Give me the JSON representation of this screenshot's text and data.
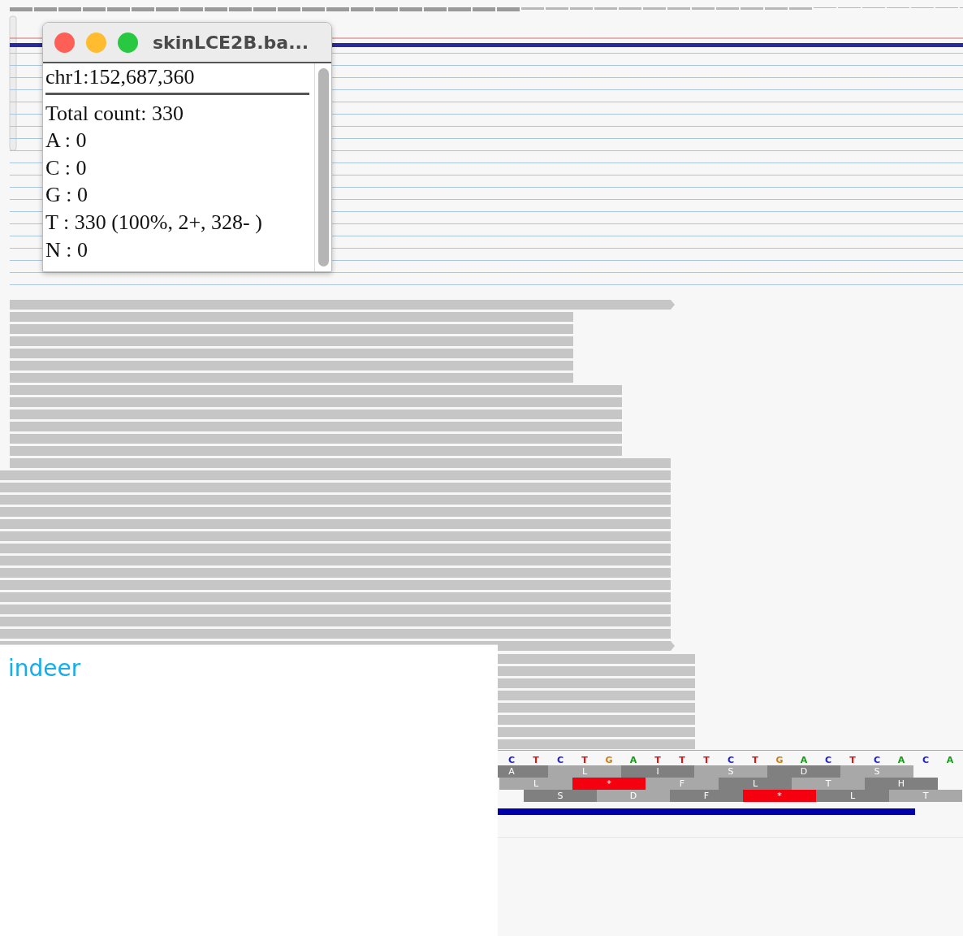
{
  "popup": {
    "title": "skinLCE2B.ba...",
    "position": "chr1:152,687,360",
    "lines": [
      "Total count: 330",
      "A : 0",
      "C : 0",
      "G : 0",
      "T : 330 (100%, 2+, 328- )",
      "N : 0"
    ]
  },
  "sequence": {
    "bases": [
      "C",
      "T",
      "C",
      "T",
      "G",
      "A",
      "T",
      "T",
      "T",
      "C",
      "T",
      "G",
      "A",
      "C",
      "T",
      "C",
      "A",
      "C",
      "A"
    ]
  },
  "translation": {
    "frames": [
      [
        {
          "letter": "A",
          "kind": "amino"
        },
        {
          "letter": "L",
          "kind": "amino"
        },
        {
          "letter": "I",
          "kind": "amino"
        },
        {
          "letter": "S",
          "kind": "amino"
        },
        {
          "letter": "D",
          "kind": "amino"
        },
        {
          "letter": "S",
          "kind": "amino"
        }
      ],
      [
        {
          "letter": "L",
          "kind": "amino"
        },
        {
          "letter": "*",
          "kind": "stop"
        },
        {
          "letter": "F",
          "kind": "amino"
        },
        {
          "letter": "L",
          "kind": "amino"
        },
        {
          "letter": "T",
          "kind": "amino"
        },
        {
          "letter": "H",
          "kind": "amino"
        }
      ],
      [
        {
          "letter": "S",
          "kind": "amino"
        },
        {
          "letter": "D",
          "kind": "amino"
        },
        {
          "letter": "F",
          "kind": "amino"
        },
        {
          "letter": "*",
          "kind": "stop"
        },
        {
          "letter": "L",
          "kind": "amino"
        },
        {
          "letter": "T",
          "kind": "amino"
        }
      ]
    ]
  },
  "overlay": {
    "text": "indeer"
  }
}
